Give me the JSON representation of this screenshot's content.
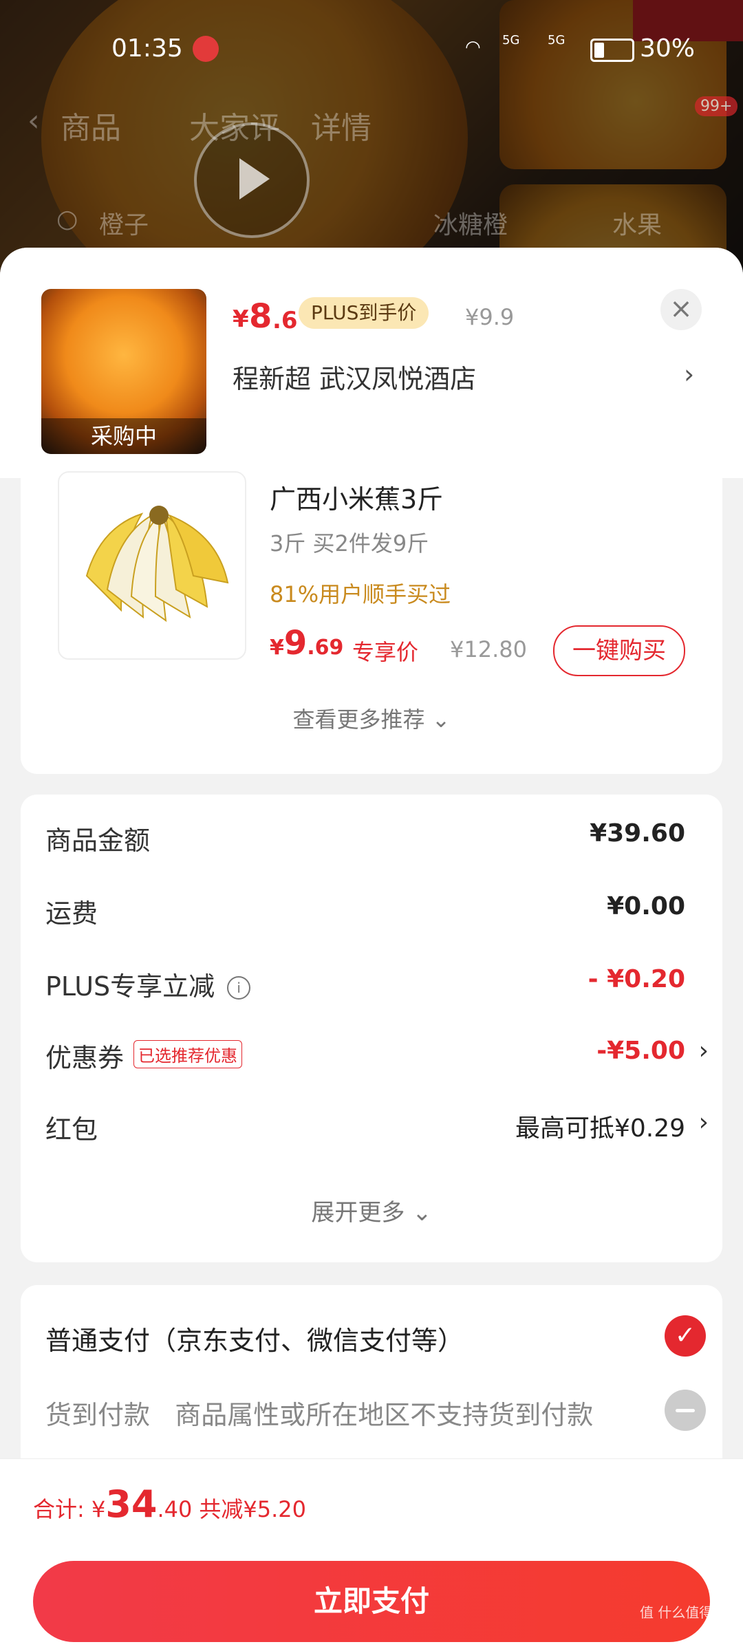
{
  "status_bar": {
    "time": "01:35",
    "battery": "30%",
    "signal1": "5G",
    "signal2": "5G"
  },
  "background": {
    "tabs": [
      "商品",
      "大家评",
      "详情"
    ],
    "search_hint": "橙子",
    "tags": [
      "冰糖橙",
      "水果"
    ],
    "badge": "99+"
  },
  "sheet_header": {
    "price_currency": "¥",
    "price_int": "8",
    "price_dec": ".6",
    "plus_label": "PLUS到手价",
    "original_price": "¥9.9",
    "product_tag": "采购中",
    "address": "程新超  武汉凤悦酒店"
  },
  "recommend": {
    "title": "广西小米蕉3斤",
    "spec": "3斤 买2件发9斤",
    "hot": "81%用户顺手买过",
    "price_currency": "¥",
    "price_int": "9",
    "price_dec": ".69",
    "exclusive": "专享价",
    "original_price": "¥12.80",
    "buy_label": "一键购买",
    "more_label": "查看更多推荐 ⌄"
  },
  "summary": {
    "rows": [
      {
        "label": "商品金额",
        "value": "¥39.60"
      },
      {
        "label": "运费",
        "value": "¥0.00"
      },
      {
        "label": "PLUS专享立减",
        "value": "- ¥0.20"
      },
      {
        "label": "优惠券",
        "tag": "已选推荐优惠",
        "value": "-¥5.00"
      },
      {
        "label": "红包",
        "value": "最高可抵¥0.29"
      }
    ],
    "expand_label": "展开更多 ⌄"
  },
  "payment": {
    "normal": "普通支付（京东支付、微信支付等）",
    "cod": "货到付款",
    "cod_note": "商品属性或所在地区不支持货到付款"
  },
  "bottom": {
    "total_label": "合计: ",
    "currency": "¥",
    "total_int": "34",
    "total_dec": ".40",
    "saved": "共减¥5.20",
    "pay_label": "立即支付"
  },
  "watermark": "值 什么值得买"
}
